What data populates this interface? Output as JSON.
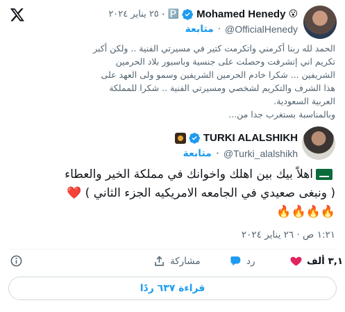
{
  "icons": {
    "x_logo": "x-logo-icon",
    "verified": "verified-badge-icon",
    "like": "heart-icon",
    "reply": "reply-bubble-icon",
    "share": "share-upload-icon",
    "info": "info-icon"
  },
  "colors": {
    "accent": "#1d9bf0",
    "like": "#e0245e",
    "muted": "#536471",
    "text": "#0f1419"
  },
  "quoted": {
    "name": "Mohamed Henedy",
    "emoji": "😮",
    "tag_emoji": "🅿️",
    "date": "٢٥ يناير ٢٠٢٤",
    "handle": "@OfficialHenedy",
    "follow": "متابعة",
    "text_lines": [
      "الحمد لله ربنا أكرمني واتكرمت كتير في مسيرتي الفنية .. ولكن أكبر",
      "تكريم اني إتشرفت وحصلت على جنسية وباسبور بلاد الحرمين",
      "الشريفين ... شكرا خادم الحرمين الشريفين وسمو ولى العهد على",
      "هذا الشرف والتكريم لشخصي ومسيرتي الفنية .. شكرا للمملكة",
      "العربية السعودية.",
      "وبالمناسبة بستغرب جدا من..."
    ]
  },
  "reply": {
    "name": "TURKI ALALSHIKH",
    "handle": "@Turki_alalshikh",
    "follow": "متابعة",
    "line1": "اهلاً بيك بين اهلك واخوانك في مملكة الخير والعطاء",
    "heart": "❤️",
    "line2": "( ونبغى صعيدي في الجامعه الامريكيه الجزء الثاني )",
    "fires": "🔥🔥🔥🔥",
    "timestamp": "١:٢١ ص · ٢٦ يناير ٢٠٢٤"
  },
  "actions": {
    "likes": "٣,١ ألف",
    "reply": "رد",
    "share": "مشاركة"
  },
  "read_replies": "قراءة ٦٣٧ ردًا"
}
